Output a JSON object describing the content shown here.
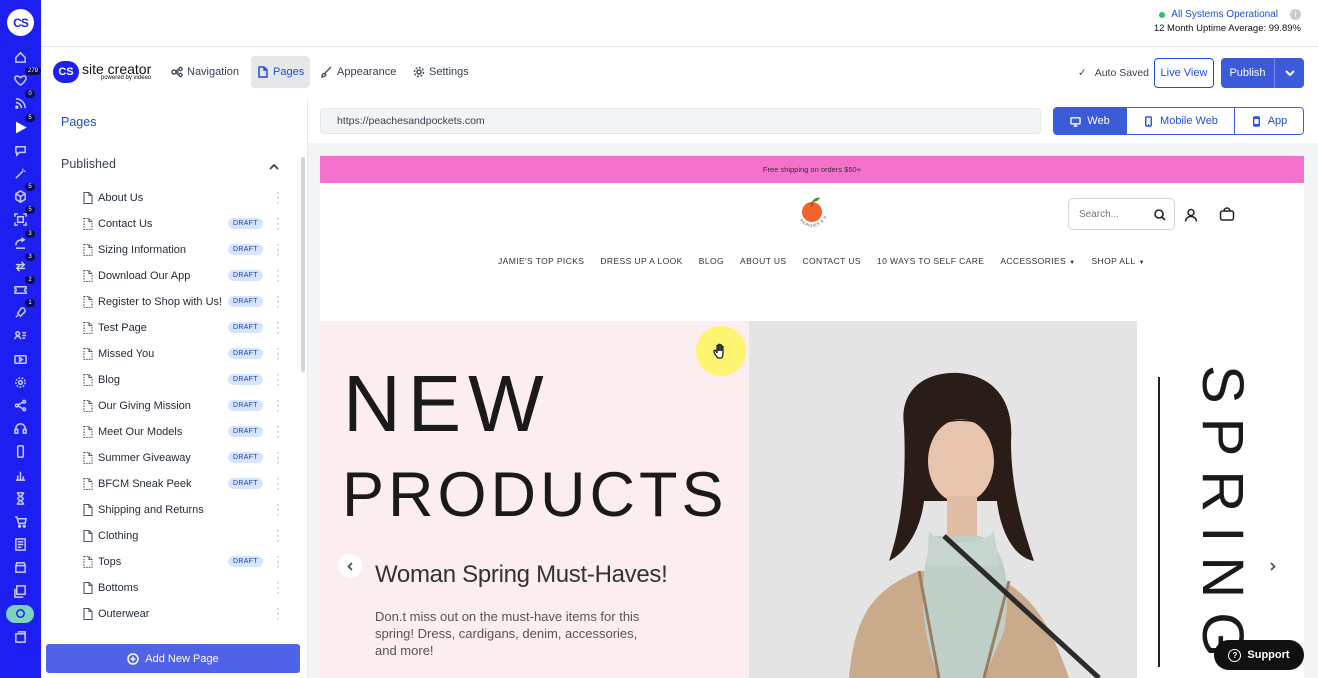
{
  "rail": {
    "logo": "CS",
    "icons": [
      {
        "name": "home-icon",
        "badge": ""
      },
      {
        "name": "heart-icon",
        "badge": "279"
      },
      {
        "name": "rss-icon",
        "badge": "0"
      },
      {
        "name": "play-icon",
        "badge": "5"
      },
      {
        "name": "chat-icon",
        "badge": ""
      },
      {
        "name": "magic-wand-icon",
        "badge": ""
      },
      {
        "name": "cube-icon",
        "badge": "5"
      },
      {
        "name": "scan-icon",
        "badge": "5"
      },
      {
        "name": "share-icon",
        "badge": "3"
      },
      {
        "name": "transfer-icon",
        "badge": "3"
      },
      {
        "name": "ticket-icon",
        "badge": "2"
      },
      {
        "name": "rocket-icon",
        "badge": "1"
      },
      {
        "name": "contacts-icon",
        "badge": ""
      },
      {
        "name": "video-icon",
        "badge": ""
      },
      {
        "name": "gear-icon",
        "badge": ""
      },
      {
        "name": "network-icon",
        "badge": ""
      },
      {
        "name": "headset-icon",
        "badge": ""
      },
      {
        "name": "phone-icon",
        "badge": ""
      },
      {
        "name": "bar-chart-icon",
        "badge": ""
      },
      {
        "name": "hourglass-icon",
        "badge": ""
      },
      {
        "name": "cart-icon",
        "badge": ""
      },
      {
        "name": "list-icon",
        "badge": ""
      },
      {
        "name": "store-icon",
        "badge": ""
      },
      {
        "name": "layers-icon",
        "badge": ""
      },
      {
        "name": "site-creator-icon",
        "badge": ""
      },
      {
        "name": "gallery-icon",
        "badge": ""
      }
    ]
  },
  "status": {
    "systems": "All Systems Operational",
    "uptime": "12 Month Uptime Average: 99.89%",
    "info": "i"
  },
  "toolbar": {
    "brand_logo": "CS",
    "brand_name": "site creator",
    "brand_sub": "powered by videeo",
    "tabs": [
      "Navigation",
      "Pages",
      "Appearance",
      "Settings"
    ],
    "active_tab": "Pages",
    "autosave": "Auto Saved",
    "live_view": "Live View",
    "publish": "Publish"
  },
  "sidebar": {
    "title": "Pages",
    "section": "Published",
    "draft_label": "DRAFT",
    "pages": [
      {
        "label": "About Us",
        "draft": false
      },
      {
        "label": "Contact Us",
        "draft": true
      },
      {
        "label": "Sizing Information",
        "draft": true
      },
      {
        "label": "Download Our App",
        "draft": true
      },
      {
        "label": "Register to Shop with Us!",
        "draft": true
      },
      {
        "label": "Test Page",
        "draft": true
      },
      {
        "label": "Missed You",
        "draft": true
      },
      {
        "label": "Blog",
        "draft": true
      },
      {
        "label": "Our Giving Mission",
        "draft": true
      },
      {
        "label": "Meet Our Models",
        "draft": true
      },
      {
        "label": "Summer Giveaway",
        "draft": true
      },
      {
        "label": "BFCM Sneak Peek",
        "draft": true
      },
      {
        "label": "Shipping and Returns",
        "draft": false
      },
      {
        "label": "Clothing",
        "draft": false
      },
      {
        "label": "Tops",
        "draft": true
      },
      {
        "label": "Bottoms",
        "draft": false
      },
      {
        "label": "Outerwear",
        "draft": false
      }
    ],
    "add_button": "Add New Page"
  },
  "preview": {
    "url": "https://peachesandpockets.com",
    "devices": [
      "Web",
      "Mobile Web",
      "App"
    ],
    "active_device": "Web"
  },
  "site": {
    "promo": "Free shipping on orders $50+",
    "logo_text": "PEACHES & POCKETS",
    "search_placeholder": "Search...",
    "nav": [
      {
        "label": "JAMIE'S TOP PICKS",
        "caret": false
      },
      {
        "label": "DRESS UP A LOOK",
        "caret": false
      },
      {
        "label": "BLOG",
        "caret": false
      },
      {
        "label": "ABOUT US",
        "caret": false
      },
      {
        "label": "CONTACT US",
        "caret": false
      },
      {
        "label": "10 WAYS TO SELF CARE",
        "caret": false
      },
      {
        "label": "ACCESSORIES",
        "caret": true
      },
      {
        "label": "SHOP ALL",
        "caret": true
      }
    ],
    "hero": {
      "headline1": "NEW",
      "headline2": "PRODUCTS",
      "subtitle": "Woman Spring Must-Haves!",
      "description": "Don.t miss out on the must-have items for this spring! Dress, cardigans, denim, accessories, and more!",
      "side_text": "SPRING"
    }
  },
  "support": "Support",
  "colors": {
    "rail": "#1d1ff0",
    "accent": "#3b5bdb",
    "promo": "#f572cc",
    "hero_bg": "#fcedee"
  }
}
